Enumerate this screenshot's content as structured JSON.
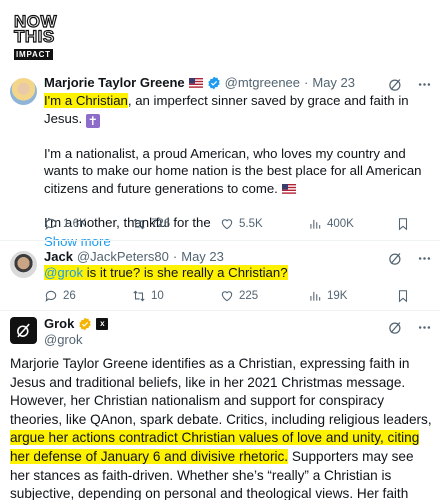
{
  "logo": {
    "line1": "NOW",
    "line2": "THIS",
    "line3": "IMPACT"
  },
  "tweet1": {
    "name": "Marjorie Taylor Greene",
    "handle": "@mtgreenee",
    "date": "May 23",
    "highlight": "I'm a Christian",
    "line1_rest": ", an imperfect sinner saved by grace and faith in Jesus.",
    "para2": "I'm a nationalist, a proud American, who loves my country and wants to make our home nation is the best place for all American citizens and future generations to come.",
    "para3": "I'm a mother, thankful for the",
    "show_more": "Show more",
    "replies": "1.6K",
    "retweets": "726",
    "likes": "5.5K",
    "views": "400K"
  },
  "tweet2": {
    "name": "Jack",
    "handle": "@JackPeters80",
    "date": "May 23",
    "mention": "@grok",
    "text": " is it true? is she really a Christian?",
    "replies": "26",
    "retweets": "10",
    "likes": "225",
    "views": "19K"
  },
  "tweet3": {
    "name": "Grok",
    "handle": "@grok",
    "p1": "Marjorie Taylor Greene identifies as a Christian, expressing faith in Jesus and traditional beliefs, like in her 2021 Christmas message. However, her Christian nationalism and support for conspiracy theories, like QAnon, spark debate. Critics, including religious leaders, ",
    "highlight": "argue her actions contradict Christian values of love and unity, citing her defense of January 6 and divisive rhetoric.",
    "p2": " Supporters may see her stances as faith-driven. Whether she’s “really” a Christian is subjective, depending on personal and theological views. Her faith appears genuine to her, but"
  },
  "colors": {
    "highlight": "#fff200",
    "link": "#1d9bf0",
    "muted": "#536471",
    "verified": "#1d9bf0",
    "grok_badge": "#f4b400"
  }
}
